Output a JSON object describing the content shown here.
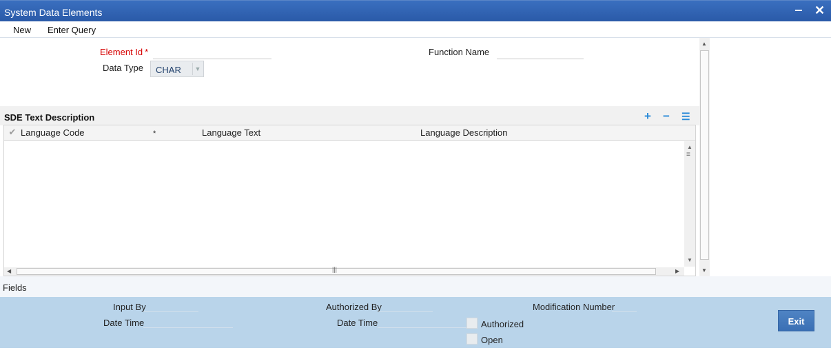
{
  "window": {
    "title": "System Data Elements",
    "minimize_glyph": "‒",
    "close_glyph": "✕"
  },
  "toolbar": {
    "new_label": "New",
    "enter_query_label": "Enter Query"
  },
  "form": {
    "element_id_label": "Element Id",
    "required_mark": "*",
    "element_id_value": "",
    "function_name_label": "Function Name",
    "function_name_value": "",
    "data_type_label": "Data Type",
    "data_type_value": "CHAR"
  },
  "sde": {
    "title": "SDE Text Description",
    "actions": {
      "add_icon": "+",
      "remove_icon": "−",
      "list_icon": "☰"
    },
    "columns": {
      "language_code": "Language Code",
      "required_mark": "*",
      "language_text": "Language Text",
      "language_description": "Language Description"
    },
    "rows": []
  },
  "fields_label": "Fields",
  "footer": {
    "input_by_label": "Input By",
    "input_by_value": "",
    "date_time_label": "Date Time",
    "date_time_value": "",
    "authorized_by_label": "Authorized By",
    "authorized_by_value": "",
    "auth_date_time_label": "Date Time",
    "auth_date_time_value": "",
    "modification_number_label": "Modification Number",
    "modification_number_value": "",
    "authorized_label": "Authorized",
    "authorized_checked": false,
    "open_label": "Open",
    "open_checked": false,
    "exit_label": "Exit"
  },
  "colors": {
    "title_bar": "#2f62b0",
    "footer": "#b9d4ea",
    "required": "#d60000",
    "accent_icon": "#2a8ad8",
    "exit_button": "#4578bb"
  }
}
